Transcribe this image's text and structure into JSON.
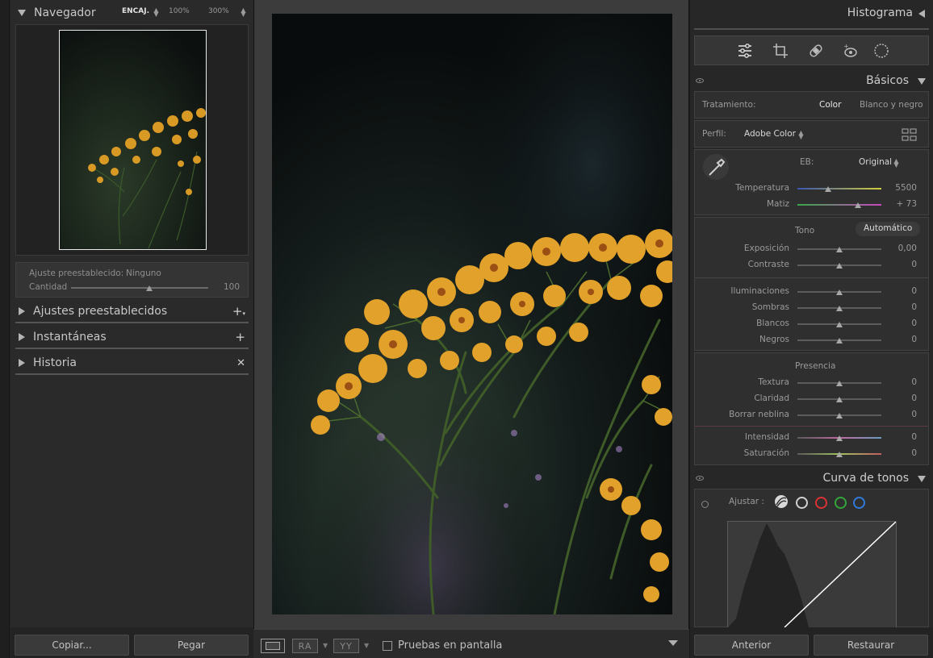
{
  "colors": {
    "panel_bg": "#262626",
    "canvas_bg": "#3c3c3c",
    "text": "#b4b4b4",
    "photo_flower": "#e1a12a"
  },
  "navigator": {
    "title": "Navegador",
    "zoom_fit": "ENCAJ.",
    "zoom_100": "100%",
    "zoom_300": "300%"
  },
  "preset_box": {
    "preset_label": "Ajuste preestablecido:",
    "preset_value": "Ninguno",
    "amount_label": "Cantidad",
    "amount_value": "100",
    "amount_level": 0.57
  },
  "left_sections": [
    {
      "title": "Ajustes preestablecidos",
      "action_icon": "plus-dropdown-icon"
    },
    {
      "title": "Instantáneas",
      "action_icon": "plus-icon"
    },
    {
      "title": "Historia",
      "action_icon": "close-icon"
    }
  ],
  "left_buttons": {
    "copy": "Copiar...",
    "paste": "Pegar"
  },
  "toolbar": {
    "view_single_icon": "loupe-view-icon",
    "compare_ra": "RA",
    "compare_yy": "YY",
    "soft_proof_label": "Pruebas en pantalla",
    "soft_proof_checked": false
  },
  "right": {
    "histogram_title": "Histograma",
    "tools": [
      "sliders-icon",
      "crop-icon",
      "healing-icon",
      "red-eye-icon",
      "mask-icon"
    ],
    "basics_title": "Básicos",
    "treatment": {
      "label": "Tratamiento:",
      "color": "Color",
      "bw": "Blanco y negro",
      "selected": "Color"
    },
    "profile": {
      "label": "Perfil:",
      "value": "Adobe Color"
    },
    "wb": {
      "label": "EB:",
      "value": "Original"
    },
    "temp": {
      "label": "Temperatura",
      "value": "5500",
      "level": 0.37
    },
    "tint": {
      "label": "Matiz",
      "value": "+ 73",
      "level": 0.72
    },
    "tone": {
      "label": "Tono",
      "auto": "Automático"
    },
    "exposure": {
      "label": "Exposición",
      "value": "0,00",
      "level": 0.5
    },
    "contrast": {
      "label": "Contraste",
      "value": "0",
      "level": 0.5
    },
    "highlights": {
      "label": "Iluminaciones",
      "value": "0",
      "level": 0.5
    },
    "shadows": {
      "label": "Sombras",
      "value": "0",
      "level": 0.5
    },
    "whites": {
      "label": "Blancos",
      "value": "0",
      "level": 0.5
    },
    "blacks": {
      "label": "Negros",
      "value": "0",
      "level": 0.5
    },
    "presence": {
      "label": "Presencia"
    },
    "texture": {
      "label": "Textura",
      "value": "0",
      "level": 0.5
    },
    "clarity": {
      "label": "Claridad",
      "value": "0",
      "level": 0.5
    },
    "dehaze": {
      "label": "Borrar neblina",
      "value": "0",
      "level": 0.5
    },
    "vibrance": {
      "label": "Intensidad",
      "value": "0",
      "level": 0.5
    },
    "saturation": {
      "label": "Saturación",
      "value": "0",
      "level": 0.5
    },
    "curve_title": "Curva de tonos",
    "curve_adjust_label": "Ajustar :",
    "buttons": {
      "previous": "Anterior",
      "reset": "Restaurar"
    }
  }
}
